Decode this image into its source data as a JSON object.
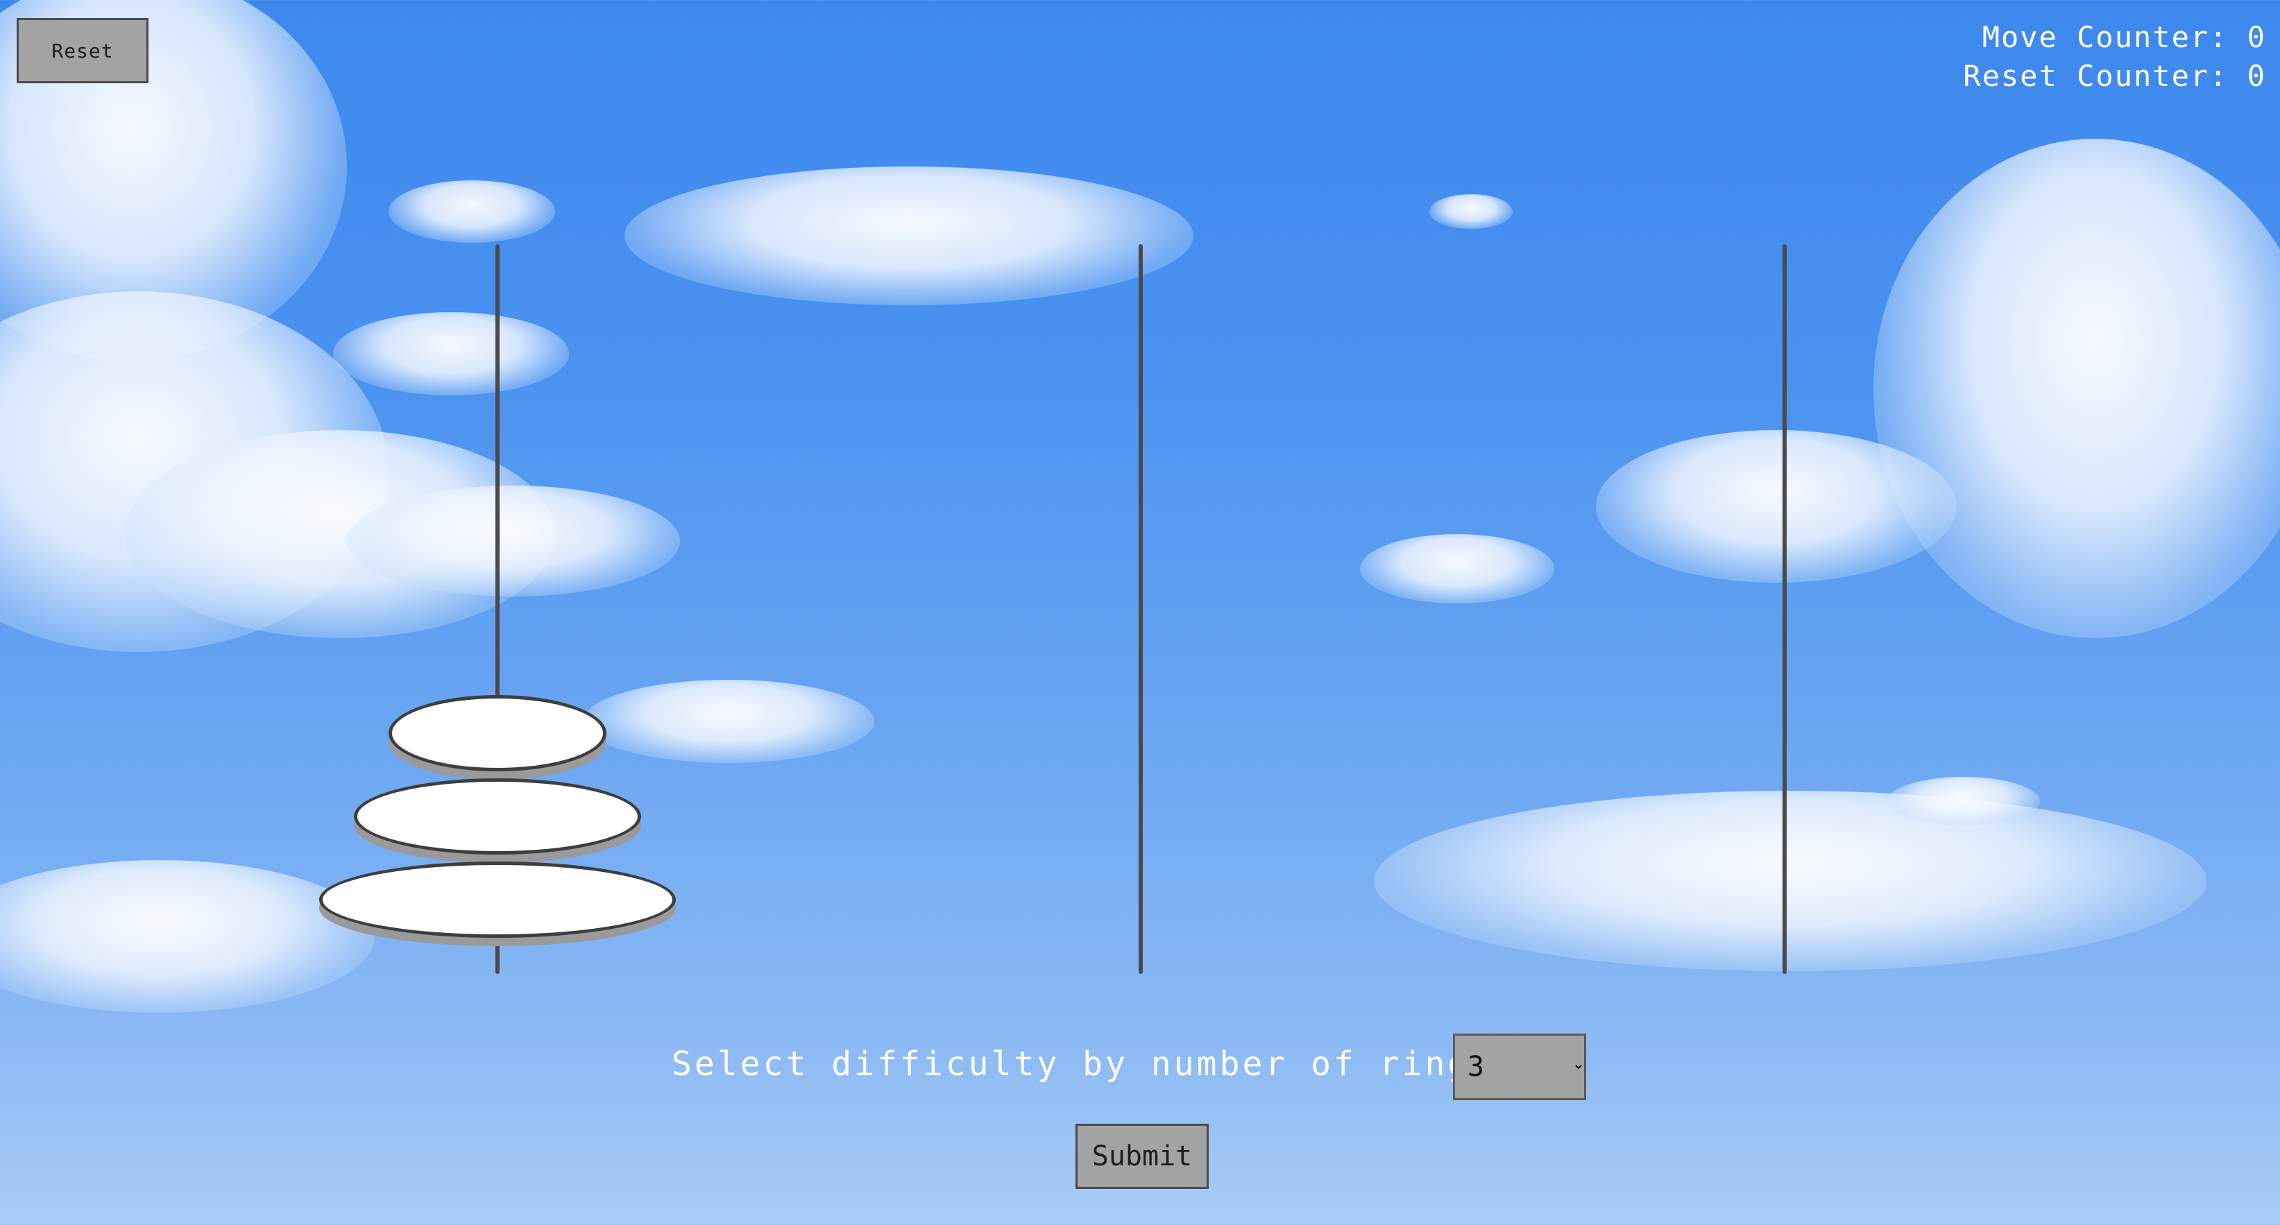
{
  "controls": {
    "reset_label": "Reset",
    "submit_label": "Submit"
  },
  "counters": {
    "move_counter_text": "Move Counter: 0",
    "reset_counter_text": "Reset Counter: 0",
    "move_count": 0,
    "reset_count": 0
  },
  "difficulty": {
    "label": "Select difficulty by number of rings:",
    "selected": "3"
  },
  "game": {
    "pegs": [
      {
        "rings": [
          1,
          2,
          3
        ]
      },
      {
        "rings": []
      },
      {
        "rings": []
      }
    ]
  },
  "colors": {
    "sky_top": "#3d88ee",
    "sky_bottom": "#a9ccf6",
    "button_gray": "#a3a3a3",
    "peg": "#4a4a4a",
    "ring_fill": "#ffffff",
    "ring_outline": "#3e3e3e",
    "text": "#ffffff"
  }
}
